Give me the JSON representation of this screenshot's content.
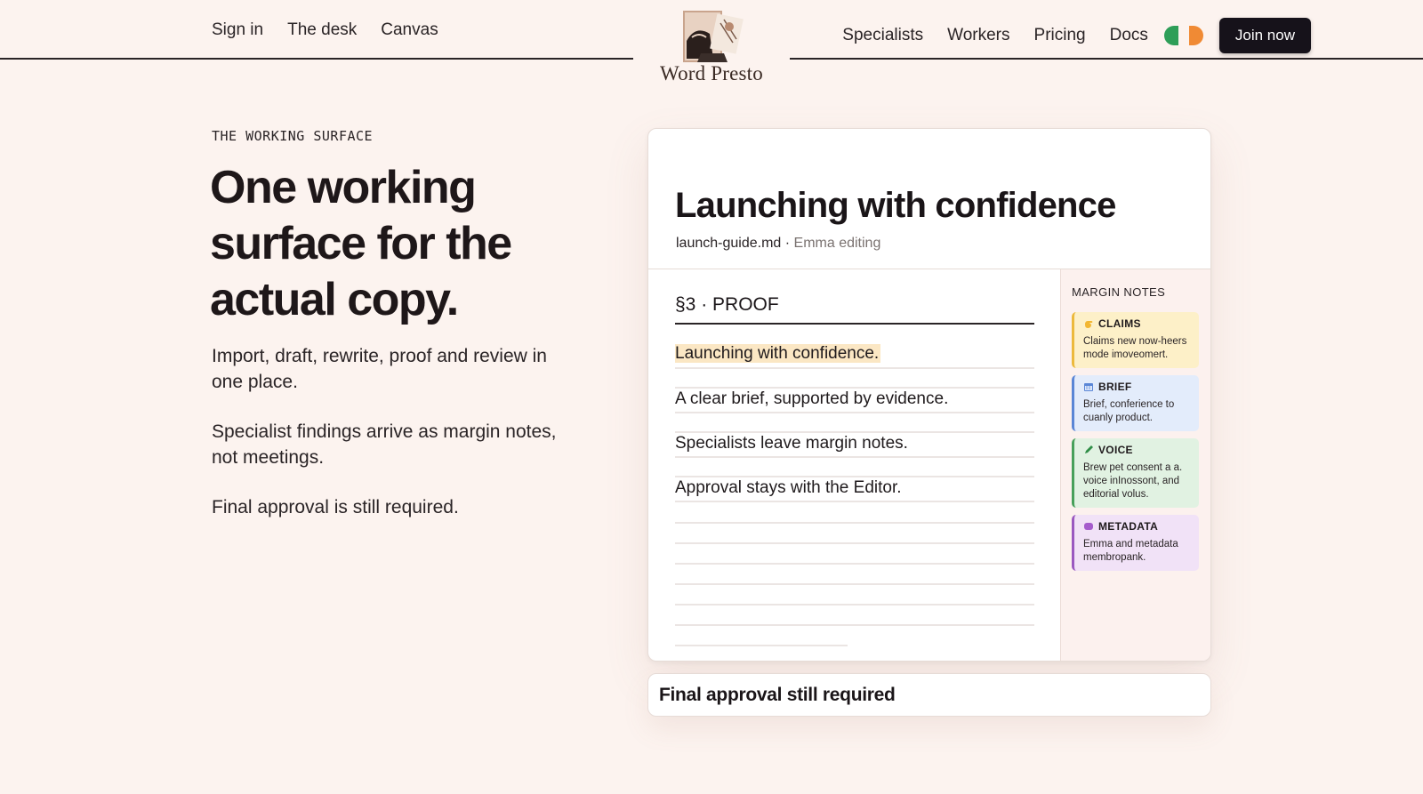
{
  "header": {
    "nav_left": [
      {
        "label": "Sign in"
      },
      {
        "label": "The desk"
      },
      {
        "label": "Canvas"
      }
    ],
    "nav_right": [
      {
        "label": "Specialists"
      },
      {
        "label": "Workers"
      },
      {
        "label": "Pricing"
      },
      {
        "label": "Docs"
      }
    ],
    "logo_text": "Word Presto",
    "join_label": "Join now",
    "theme_colors": {
      "left": "#2e9e58",
      "right": "#f08a34"
    }
  },
  "hero": {
    "eyebrow": "THE WORKING SURFACE",
    "headline": "One working surface for the actual copy.",
    "paragraphs": [
      "Import, draft, rewrite, proof and review in one place.",
      "Specialist findings arrive as margin notes, not meetings.",
      "Final approval is still required."
    ]
  },
  "editor": {
    "title": "Launching with confidence",
    "file": "launch-guide.md",
    "separator": " · ",
    "status": "Emma editing",
    "section": "§3 · PROOF",
    "lines": [
      "Launching with confidence.",
      "A clear brief, supported by evidence.",
      "Specialists leave margin notes.",
      "Approval stays with the Editor."
    ],
    "margin_heading": "MARGIN NOTES",
    "notes": [
      {
        "title": "CLAIMS",
        "body": "Claims new now-heers mode imoveomert.",
        "icon": "hand-icon",
        "color": "#ecb93c"
      },
      {
        "title": "BRIEF",
        "body": "Brief, conferience to cuanly product.",
        "icon": "calendar-icon",
        "color": "#5a86d6"
      },
      {
        "title": "VOICE",
        "body": "Brew pet consent a a. voice inInossont, and editorial volus.",
        "icon": "pencil-icon",
        "color": "#47a05a"
      },
      {
        "title": "METADATA",
        "body": "Emma and metadata membropank.",
        "icon": "tag-icon",
        "color": "#9a58c0"
      }
    ]
  },
  "approval_banner": "Final approval still required"
}
